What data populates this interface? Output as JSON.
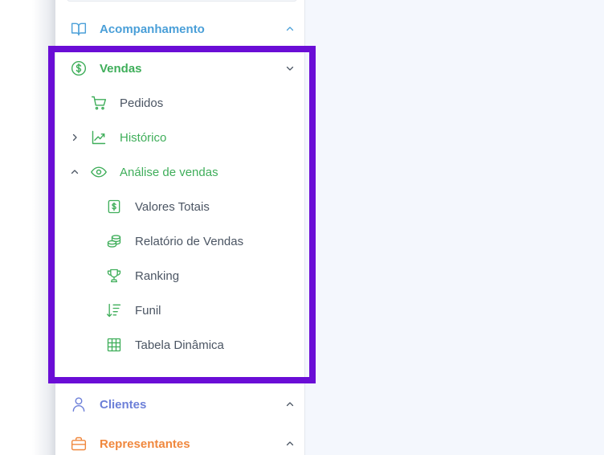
{
  "colors": {
    "acompanhamento": "#4a9fd8",
    "vendas": "#3fae5a",
    "clientes": "#6c7fd8",
    "representantes": "#f0883e",
    "subtext": "#4b5563",
    "highlight": "#6a0dd6"
  },
  "sidebar": {
    "sections": [
      {
        "key": "acompanhamento",
        "label": "Acompanhamento",
        "icon": "book-open-icon",
        "chevron": "chevron-up-icon"
      },
      {
        "key": "vendas",
        "label": "Vendas",
        "icon": "dollar-circle-icon",
        "chevron": "chevron-down-icon"
      },
      {
        "key": "clientes",
        "label": "Clientes",
        "icon": "user-icon",
        "chevron": "chevron-up-icon"
      },
      {
        "key": "representantes",
        "label": "Representantes",
        "icon": "briefcase-icon",
        "chevron": "chevron-up-icon"
      }
    ],
    "vendas_items": [
      {
        "label": "Pedidos",
        "icon": "shopping-cart-icon"
      },
      {
        "label": "Histórico",
        "icon": "trending-up-icon",
        "chevron": "chevron-right-icon"
      },
      {
        "label": "Análise de vendas",
        "icon": "eye-icon",
        "chevron": "chevron-up-icon"
      }
    ],
    "analise_items": [
      {
        "label": "Valores Totais",
        "icon": "dollar-square-icon"
      },
      {
        "label": "Relatório de Vendas",
        "icon": "coins-stack-icon"
      },
      {
        "label": "Ranking",
        "icon": "trophy-icon"
      },
      {
        "label": "Funil",
        "icon": "sort-descending-icon"
      },
      {
        "label": "Tabela Dinâmica",
        "icon": "table-grid-icon"
      }
    ]
  }
}
